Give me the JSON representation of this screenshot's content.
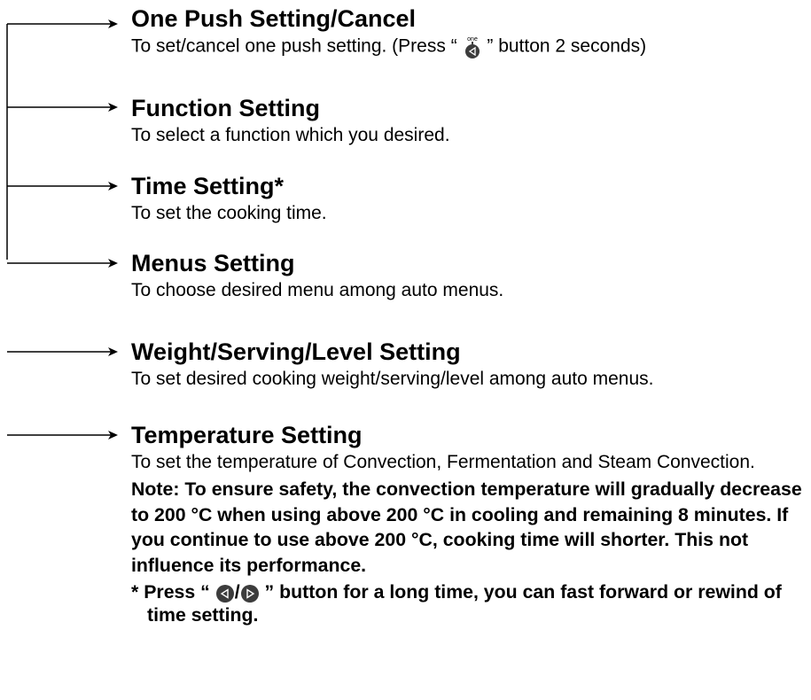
{
  "colors": {
    "ink": "#000000",
    "icon_fill": "#3c3c3c",
    "background": "#ffffff"
  },
  "items": [
    {
      "title": "One Push Setting/Cancel",
      "desc_before": "To set/cancel one push setting. (Press “ ",
      "icon": "one-push-left-button-icon",
      "icon_caption": "one",
      "desc_after": " ” button 2 seconds)"
    },
    {
      "title": "Function Setting",
      "desc": "To select a function which you desired."
    },
    {
      "title": "Time Setting*",
      "desc": "To set the cooking time."
    },
    {
      "title": "Menus Setting",
      "desc": "To choose desired menu among auto menus."
    },
    {
      "title": "Weight/Serving/Level Setting",
      "desc": "To set desired cooking weight/serving/level among auto menus."
    },
    {
      "title": "Temperature Setting",
      "desc": "To set the temperature of Convection, Fermentation and Steam Convection.",
      "note": "Note: To ensure safety, the convection temperature will gradually decrease to 200 °C when using above 200 °C in cooling and remaining 8 minutes. If you continue to use above 200 °C, cooking time will shorter. This not influence its performance.",
      "footnote_before": "* Press “ ",
      "footnote_icons": [
        "left-arrow-button-icon",
        "right-arrow-button-icon"
      ],
      "footnote_sep": "/",
      "footnote_after": " ” button for a long time, you can fast forward or rewind of time setting."
    }
  ]
}
